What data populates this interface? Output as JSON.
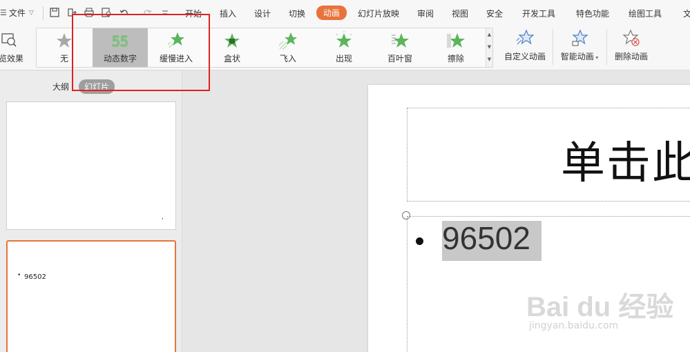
{
  "menubar": {
    "file_label": "文件",
    "tabs": [
      {
        "label": "开始"
      },
      {
        "label": "插入"
      },
      {
        "label": "设计"
      },
      {
        "label": "切换"
      },
      {
        "label": "动画",
        "active": true
      },
      {
        "label": "幻灯片放映"
      },
      {
        "label": "审阅"
      },
      {
        "label": "视图"
      },
      {
        "label": "安全"
      },
      {
        "label": "开发工具"
      },
      {
        "label": "特色功能"
      },
      {
        "label": "绘图工具"
      },
      {
        "label": "文"
      }
    ],
    "active_color": "#e8733c"
  },
  "ribbon": {
    "preview_label": "览效果",
    "gallery": [
      {
        "label": "无",
        "icon": "gray-star-icon"
      },
      {
        "label": "动态数字",
        "icon": "digits-icon",
        "selected": true
      },
      {
        "label": "缓慢进入",
        "icon": "green-star-icon"
      },
      {
        "label": "盒状",
        "icon": "box-star-icon"
      },
      {
        "label": "飞入",
        "icon": "fly-in-star-icon"
      },
      {
        "label": "出现",
        "icon": "appear-star-icon"
      },
      {
        "label": "百叶窗",
        "icon": "blinds-star-icon"
      },
      {
        "label": "擦除",
        "icon": "wipe-star-icon"
      }
    ],
    "custom_animation": "自定义动画",
    "smart_animation": "智能动画",
    "delete_animation": "删除动画"
  },
  "left_panel": {
    "tab_outline": "大纲",
    "tab_slides": "幻灯片",
    "thumb2_text": "96502"
  },
  "slide": {
    "title_text": "单击此",
    "body_text": "96502"
  },
  "watermark": {
    "main": "Bai du 经验",
    "sub": "jingyan.baidu.com"
  },
  "colors": {
    "accent": "#e8733c",
    "star_green": "#5bb55b",
    "star_blue": "#4a7fc4",
    "highlight_red": "#e02020"
  }
}
